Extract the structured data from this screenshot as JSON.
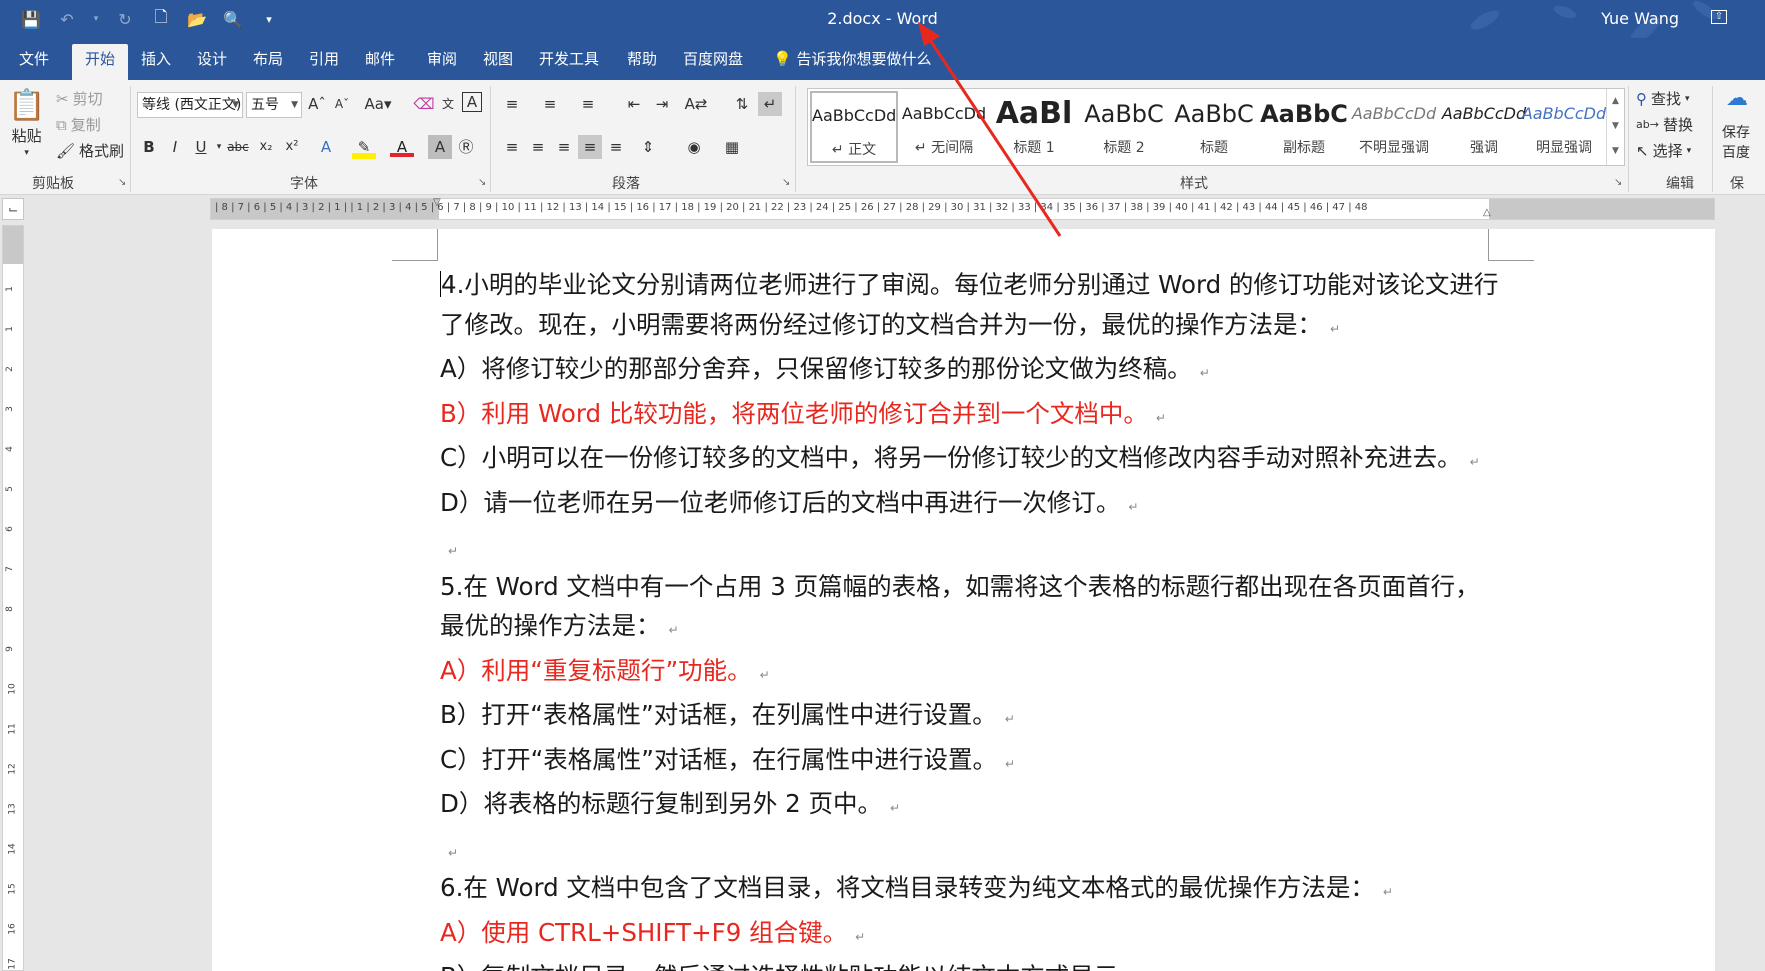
{
  "window": {
    "title": "2.docx  -  Word",
    "user": "Yue Wang"
  },
  "tabs": [
    "文件",
    "开始",
    "插入",
    "设计",
    "布局",
    "引用",
    "邮件",
    "审阅",
    "视图",
    "开发工具",
    "帮助",
    "百度网盘"
  ],
  "active_tab": "开始",
  "tell_me": "告诉我你想要做什么",
  "clipboard": {
    "paste": "粘贴",
    "cut": "剪切",
    "copy": "复制",
    "format_painter": "格式刷",
    "group_label": "剪贴板"
  },
  "font": {
    "name": "等线 (西文正文)",
    "size": "五号",
    "group_label": "字体"
  },
  "paragraph": {
    "group_label": "段落"
  },
  "styles": {
    "group_label": "样式",
    "items": [
      {
        "sample": "AaBbCcDd",
        "name": "↵ 正文"
      },
      {
        "sample": "AaBbCcDd",
        "name": "↵ 无间隔"
      },
      {
        "sample": "AaBl",
        "name": "标题 1"
      },
      {
        "sample": "AaBbC",
        "name": "标题 2"
      },
      {
        "sample": "AaBbC",
        "name": "标题"
      },
      {
        "sample": "AaBbC",
        "name": "副标题"
      },
      {
        "sample": "AaBbCcDd",
        "name": "不明显强调"
      },
      {
        "sample": "AaBbCcDd",
        "name": "强调"
      },
      {
        "sample": "AaBbCcDd",
        "name": "明显强调"
      }
    ]
  },
  "editing": {
    "find": "查找",
    "replace": "替换",
    "select": "选择",
    "group_label": "编辑"
  },
  "save_group": {
    "label1": "保存",
    "label2": "百度",
    "label3": "保"
  },
  "ruler": {
    "numbers": "| 8 | 7 | 6 | 5 | 4 | 3 | 2 | 1 |   | 1 | 2 | 3 | 4 | 5 | 6 | 7 | 8 | 9 | 10 | 11 | 12 | 13 | 14 | 15 | 16 | 17 | 18 | 19 | 20 | 21 | 22 | 23 | 24 | 25 | 26 | 27 | 28 | 29 | 30 | 31 | 32 | 33 | 34 | 35 | 36 | 37 | 38 | 39 | 40 | 41 | 42 | 43 | 44 | 45 | 46 | 47 | 48",
    "vertical": [
      "1",
      "1",
      "2",
      "3",
      "4",
      "5",
      "6",
      "7",
      "8",
      "9",
      "10",
      "11",
      "12",
      "13",
      "14",
      "15",
      "16",
      "17"
    ]
  },
  "document": {
    "paragraphs": [
      {
        "text": "4.小明的毕业论文分别请两位老师进行了审阅。每位老师分别通过 Word 的修订功能对该论文进行了修改。现在，小明需要将两份经过修订的文档合并为一份，最优的操作方法是：",
        "color": "normal",
        "cursor": true
      },
      {
        "text": "A）将修订较少的那部分舍弃，只保留修订较多的那份论文做为终稿。",
        "color": "normal"
      },
      {
        "text": "B）利用 Word 比较功能，将两位老师的修订合并到一个文档中。",
        "color": "red"
      },
      {
        "text": "C）小明可以在一份修订较多的文档中，将另一份修订较少的文档修改内容手动对照补充进去。",
        "color": "normal"
      },
      {
        "text": "D）请一位老师在另一位老师修订后的文档中再进行一次修订。",
        "color": "normal"
      },
      {
        "text": "",
        "color": "normal"
      },
      {
        "text": "5.在 Word 文档中有一个占用 3 页篇幅的表格，如需将这个表格的标题行都出现在各页面首行，最优的操作方法是：",
        "color": "normal"
      },
      {
        "text": "A）利用“重复标题行”功能。",
        "color": "red"
      },
      {
        "text": "B）打开“表格属性”对话框，在列属性中进行设置。",
        "color": "normal"
      },
      {
        "text": "C）打开“表格属性”对话框，在行属性中进行设置。",
        "color": "normal"
      },
      {
        "text": "D）将表格的标题行复制到另外 2 页中。",
        "color": "normal"
      },
      {
        "text": "",
        "color": "normal"
      },
      {
        "text": "6.在 Word 文档中包含了文档目录，将文档目录转变为纯文本格式的最优操作方法是：",
        "color": "normal"
      },
      {
        "text": "A）使用 CTRL+SHIFT+F9 组合键。",
        "color": "red"
      },
      {
        "text": "B）复制文档目录，然后通过选择性粘贴功能以纯文本方式显示。",
        "color": "normal"
      }
    ],
    "paragraph_mark": "↵"
  },
  "colors": {
    "title_bar": "#2b579a",
    "answer_red": "#e8281f",
    "annotation_arrow": "#e8281f"
  }
}
